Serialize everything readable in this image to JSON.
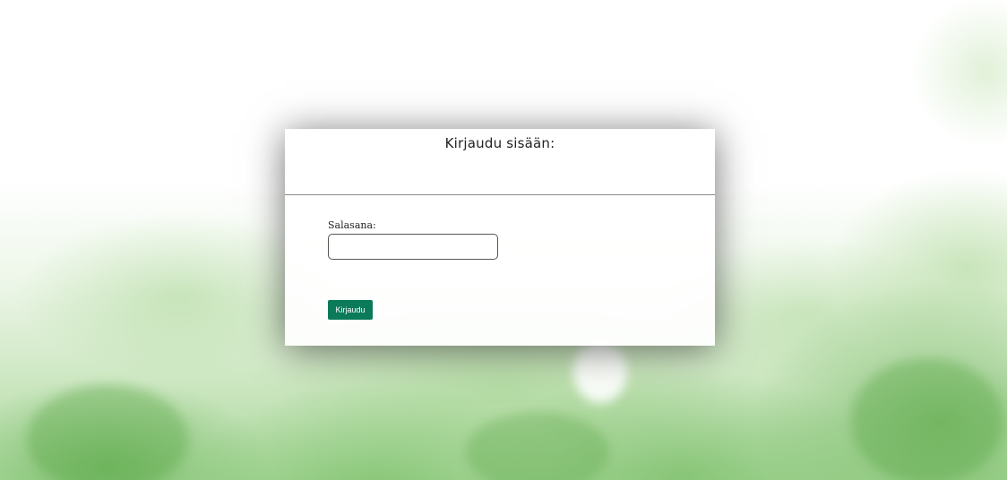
{
  "login": {
    "title": "Kirjaudu sisään:",
    "password_label": "Salasana:",
    "password_value": "",
    "submit_label": "Kirjaudu"
  },
  "colors": {
    "button_bg": "#0b7a59",
    "background_accent": "#a9d79b"
  }
}
